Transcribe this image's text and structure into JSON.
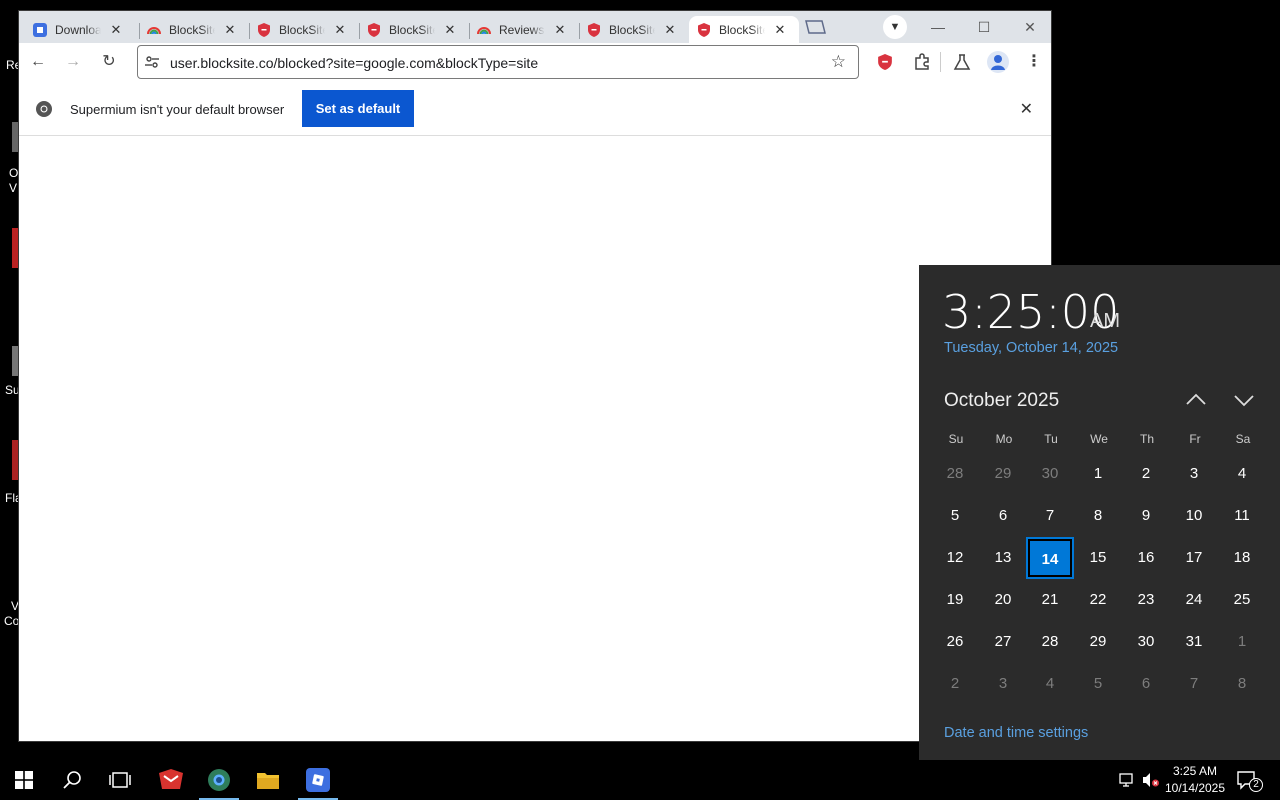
{
  "desktop": {
    "labels": [
      "Re",
      "O",
      "V",
      "Su",
      "Fla",
      "V",
      "Co"
    ]
  },
  "browser": {
    "tabs": [
      {
        "title": "Downloads",
        "icon": "app-favicon"
      },
      {
        "title": "BlockSite",
        "icon": "rainbow-favicon"
      },
      {
        "title": "BlockSite",
        "icon": "shield-favicon"
      },
      {
        "title": "BlockSite",
        "icon": "shield-favicon"
      },
      {
        "title": "Reviews",
        "icon": "rainbow-favicon"
      },
      {
        "title": "BlockSite",
        "icon": "shield-favicon"
      },
      {
        "title": "BlockSite",
        "icon": "shield-favicon",
        "active": true
      }
    ],
    "url": "user.blocksite.co/blocked?site=google.com&blockType=site",
    "infobar": {
      "message": "Supermium isn't your default browser",
      "button": "Set as default"
    }
  },
  "calendar": {
    "time": "3:25:00",
    "ampm": "AM",
    "long_date": "Tuesday, October 14, 2025",
    "month_title": "October 2025",
    "weekdays": [
      "Su",
      "Mo",
      "Tu",
      "We",
      "Th",
      "Fr",
      "Sa"
    ],
    "weeks": [
      [
        "28",
        "29",
        "30",
        "1",
        "2",
        "3",
        "4"
      ],
      [
        "5",
        "6",
        "7",
        "8",
        "9",
        "10",
        "11"
      ],
      [
        "12",
        "13",
        "14",
        "15",
        "16",
        "17",
        "18"
      ],
      [
        "19",
        "20",
        "21",
        "22",
        "23",
        "24",
        "25"
      ],
      [
        "26",
        "27",
        "28",
        "29",
        "30",
        "31",
        "1"
      ],
      [
        "2",
        "3",
        "4",
        "5",
        "6",
        "7",
        "8"
      ]
    ],
    "today": "14",
    "settings_link": "Date and time settings"
  },
  "taskbar": {
    "time": "3:25 AM",
    "date": "10/14/2025",
    "notification_count": "2"
  },
  "colors": {
    "accent": "#0078d7",
    "link": "#5aa0e0",
    "button": "#0b57d0",
    "shield": "#d9333f"
  }
}
